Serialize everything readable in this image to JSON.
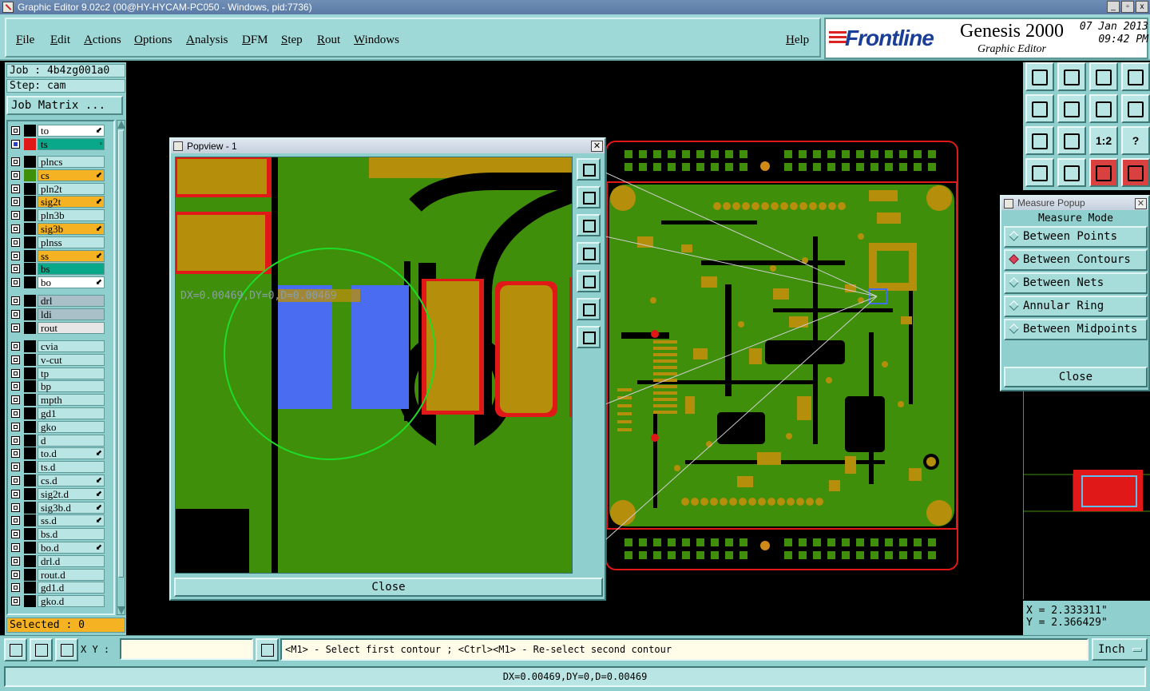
{
  "window": {
    "title": "Graphic Editor 9.02c2 (00@HY-HYCAM-PC050 - Windows, pid:7736)",
    "controls": [
      "_",
      "▫",
      "x"
    ]
  },
  "menu": {
    "items": [
      "File",
      "Edit",
      "Actions",
      "Options",
      "Analysis",
      "DFM",
      "Step",
      "Rout",
      "Windows"
    ],
    "help": "Help"
  },
  "brand": {
    "logo": "Frontline",
    "product": "Genesis 2000",
    "subtitle": "Graphic Editor",
    "date": "07 Jan 2013",
    "time": "09:42 PM"
  },
  "job": {
    "job_label": "Job : 4b4zg001a0",
    "step_label": "Step: cam",
    "matrix_button": "Job Matrix ..."
  },
  "layers": [
    {
      "name": "to",
      "color": "#000000",
      "bg": "#ffffff",
      "mark": "⬋"
    },
    {
      "name": "ts",
      "color": "#e01818",
      "bg": "#0aa88a",
      "mark": "▫",
      "active": true
    },
    {
      "name": "plncs",
      "color": "#000000",
      "bg": "#b9e6e4",
      "mark": ""
    },
    {
      "name": "cs",
      "color": "#3f8f0b",
      "bg": "#f5b324",
      "mark": "⬋"
    },
    {
      "name": "pln2t",
      "color": "#000000",
      "bg": "#b9e6e4",
      "mark": ""
    },
    {
      "name": "sig2t",
      "color": "#000000",
      "bg": "#f5b324",
      "mark": "⬋"
    },
    {
      "name": "pln3b",
      "color": "#000000",
      "bg": "#b9e6e4",
      "mark": ""
    },
    {
      "name": "sig3b",
      "color": "#000000",
      "bg": "#f5b324",
      "mark": "⬋"
    },
    {
      "name": "plnss",
      "color": "#000000",
      "bg": "#b9e6e4",
      "mark": ""
    },
    {
      "name": "ss",
      "color": "#000000",
      "bg": "#f5b324",
      "mark": "⬋"
    },
    {
      "name": "bs",
      "color": "#000000",
      "bg": "#0aa88a",
      "mark": ""
    },
    {
      "name": "bo",
      "color": "#000000",
      "bg": "#ffffff",
      "mark": "⬋"
    },
    {
      "name": "drl",
      "color": "#000000",
      "bg": "#a9c0c8",
      "mark": ""
    },
    {
      "name": "ldi",
      "color": "#000000",
      "bg": "#a9c0c8",
      "mark": ""
    },
    {
      "name": "rout",
      "color": "#000000",
      "bg": "#e6e6e6",
      "mark": ""
    },
    {
      "name": "cvia",
      "color": "#000000",
      "bg": "#b9e6e4",
      "mark": ""
    },
    {
      "name": "v-cut",
      "color": "#000000",
      "bg": "#b9e6e4",
      "mark": ""
    },
    {
      "name": "tp",
      "color": "#000000",
      "bg": "#b9e6e4",
      "mark": ""
    },
    {
      "name": "bp",
      "color": "#000000",
      "bg": "#b9e6e4",
      "mark": ""
    },
    {
      "name": "mpth",
      "color": "#000000",
      "bg": "#b9e6e4",
      "mark": ""
    },
    {
      "name": "gd1",
      "color": "#000000",
      "bg": "#b9e6e4",
      "mark": ""
    },
    {
      "name": "gko",
      "color": "#000000",
      "bg": "#b9e6e4",
      "mark": ""
    },
    {
      "name": "d",
      "color": "#000000",
      "bg": "#b9e6e4",
      "mark": ""
    },
    {
      "name": "to.d",
      "color": "#000000",
      "bg": "#b9e6e4",
      "mark": "⬋"
    },
    {
      "name": "ts.d",
      "color": "#000000",
      "bg": "#b9e6e4",
      "mark": ""
    },
    {
      "name": "cs.d",
      "color": "#000000",
      "bg": "#b9e6e4",
      "mark": "⬋"
    },
    {
      "name": "sig2t.d",
      "color": "#000000",
      "bg": "#b9e6e4",
      "mark": "⬋"
    },
    {
      "name": "sig3b.d",
      "color": "#000000",
      "bg": "#b9e6e4",
      "mark": "⬋"
    },
    {
      "name": "ss.d",
      "color": "#000000",
      "bg": "#b9e6e4",
      "mark": "⬋"
    },
    {
      "name": "bs.d",
      "color": "#000000",
      "bg": "#b9e6e4",
      "mark": ""
    },
    {
      "name": "bo.d",
      "color": "#000000",
      "bg": "#b9e6e4",
      "mark": "⬋"
    },
    {
      "name": "drl.d",
      "color": "#000000",
      "bg": "#b9e6e4",
      "mark": ""
    },
    {
      "name": "rout.d",
      "color": "#000000",
      "bg": "#b9e6e4",
      "mark": ""
    },
    {
      "name": "gd1.d",
      "color": "#000000",
      "bg": "#b9e6e4",
      "mark": ""
    },
    {
      "name": "gko.d",
      "color": "#000000",
      "bg": "#b9e6e4",
      "mark": ""
    }
  ],
  "selected": "Selected : 0",
  "popview": {
    "title": "Popview - 1",
    "measure_text": "DX=0.00469,DY=0,D=0.00469",
    "close": "Close"
  },
  "measure_popup": {
    "title": "Measure Popup",
    "heading": "Measure Mode",
    "options": [
      {
        "label": "Between Points",
        "selected": false
      },
      {
        "label": "Between Contours",
        "selected": true
      },
      {
        "label": "Between Nets",
        "selected": false
      },
      {
        "label": "Annular Ring",
        "selected": false
      },
      {
        "label": "Between Midpoints",
        "selected": false
      }
    ],
    "close": "Close"
  },
  "toolbar_glyphs": [
    "1:2",
    "?"
  ],
  "coords": {
    "x": "X = 2.333311\"",
    "y": "Y = 2.366429\""
  },
  "command": {
    "xy_label": "X Y :",
    "xy_value": "",
    "prompt": "<M1> - Select first contour ; <Ctrl><M1> - Re-select second contour",
    "units": "Inch"
  },
  "status": "DX=0.00469,DY=0,D=0.00469",
  "colors": {
    "panel": "#8fcfcd",
    "copper": "#3f8f0b",
    "pad": "#b58e0b",
    "highlight": "#4a6cf0",
    "mask_red": "#e01818"
  }
}
